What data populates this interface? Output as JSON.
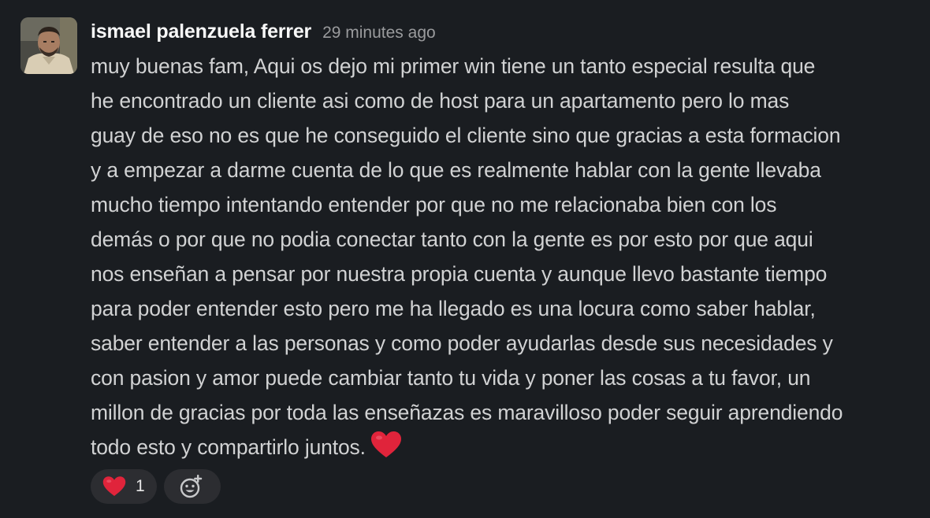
{
  "message": {
    "author": "ismael palenzuela ferrer",
    "timestamp": "29 minutes ago",
    "lines": [
      "muy buenas fam, Aqui os dejo mi primer win tiene un tanto especial resulta que",
      "he encontrado un cliente asi como de host para un apartamento pero lo mas",
      "guay de eso no es que he conseguido el cliente sino que gracias a esta formacion",
      "y a empezar a darme cuenta de lo que es realmente hablar con la gente llevaba",
      "mucho tiempo intentando entender por que no me relacionaba bien con los",
      "demás o por que no podia conectar tanto con la gente es por esto por que aqui",
      "nos enseñan a pensar por nuestra propia cuenta y aunque llevo bastante tiempo",
      "para poder entender esto pero me ha llegado es una locura como saber hablar,",
      "saber entender a las personas y como poder ayudarlas desde sus necesidades y",
      "con pasion y amor puede cambiar tanto tu vida y poner las cosas a tu favor, un",
      "millon de gracias por toda las enseñazas es maravilloso poder seguir aprendiendo",
      "todo esto y compartirlo juntos."
    ],
    "trailing_emoji": "heart-icon"
  },
  "reactions": [
    {
      "emoji": "heart-icon",
      "count": "1"
    }
  ],
  "add_reaction_icon": "add-emoji-icon",
  "colors": {
    "background": "#1a1d21",
    "text": "#d1d2d3",
    "author": "#f8f8f8",
    "timestamp": "#9a9b9d",
    "reaction_bg": "#2c2d31",
    "heart": "#e0243b"
  }
}
